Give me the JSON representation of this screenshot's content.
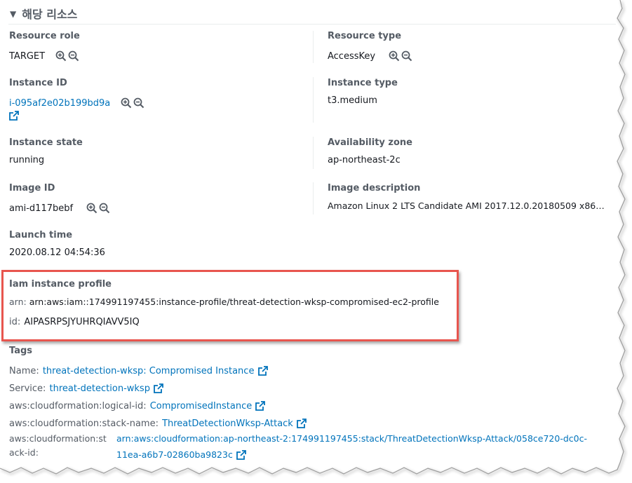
{
  "section": {
    "title": "해당 리소스"
  },
  "left": {
    "resource_role": {
      "label": "Resource role",
      "value": "TARGET"
    },
    "instance_id": {
      "label": "Instance ID",
      "value": "i-095af2e02b199bd9a"
    },
    "instance_state": {
      "label": "Instance state",
      "value": "running"
    },
    "image_id": {
      "label": "Image ID",
      "value": "ami-d117bebf"
    },
    "launch_time": {
      "label": "Launch time",
      "value": "2020.08.12 04:54:36"
    }
  },
  "right": {
    "resource_type": {
      "label": "Resource type",
      "value": "AccessKey"
    },
    "instance_type": {
      "label": "Instance type",
      "value": "t3.medium"
    },
    "availability_zone": {
      "label": "Availability zone",
      "value": "ap-northeast-2c"
    },
    "image_description": {
      "label": "Image description",
      "value": "Amazon Linux 2 LTS Candidate AMI 2017.12.0.20180509 x86…"
    }
  },
  "iam": {
    "label": "Iam instance profile",
    "arn_key": "arn:",
    "arn_value": "arn:aws:iam::174991197455:instance-profile/threat-detection-wksp-compromised-ec2-profile",
    "id_key": "id:",
    "id_value": "AIPASRPSJYUHRQIAVV5IQ"
  },
  "tags": {
    "label": "Tags",
    "items": [
      {
        "key": "Name:",
        "value": "threat-detection-wksp: Compromised Instance"
      },
      {
        "key": "Service:",
        "value": "threat-detection-wksp"
      },
      {
        "key": "aws:cloudformation:logical-id:",
        "value": "CompromisedInstance"
      },
      {
        "key": "aws:cloudformation:stack-name:",
        "value": "ThreatDetectionWksp-Attack"
      },
      {
        "key_line1": "aws:cloudformation:st",
        "key_line2": "ack-id:",
        "value_line1": "arn:aws:cloudformation:ap-northeast-2:174991197455:stack/ThreatDetectionWksp-Attack/058ce720-dc0c-",
        "value_line2": "11ea-a6b7-02860ba9823c"
      }
    ]
  },
  "icons": {
    "zoom_in": "zoom-in-icon",
    "zoom_out": "zoom-out-icon",
    "external": "external-link-icon",
    "caret": "caret-down-icon"
  },
  "colors": {
    "link": "#0073bb",
    "highlight_border": "#e8554e",
    "label": "#545b64",
    "text": "#16191f"
  }
}
